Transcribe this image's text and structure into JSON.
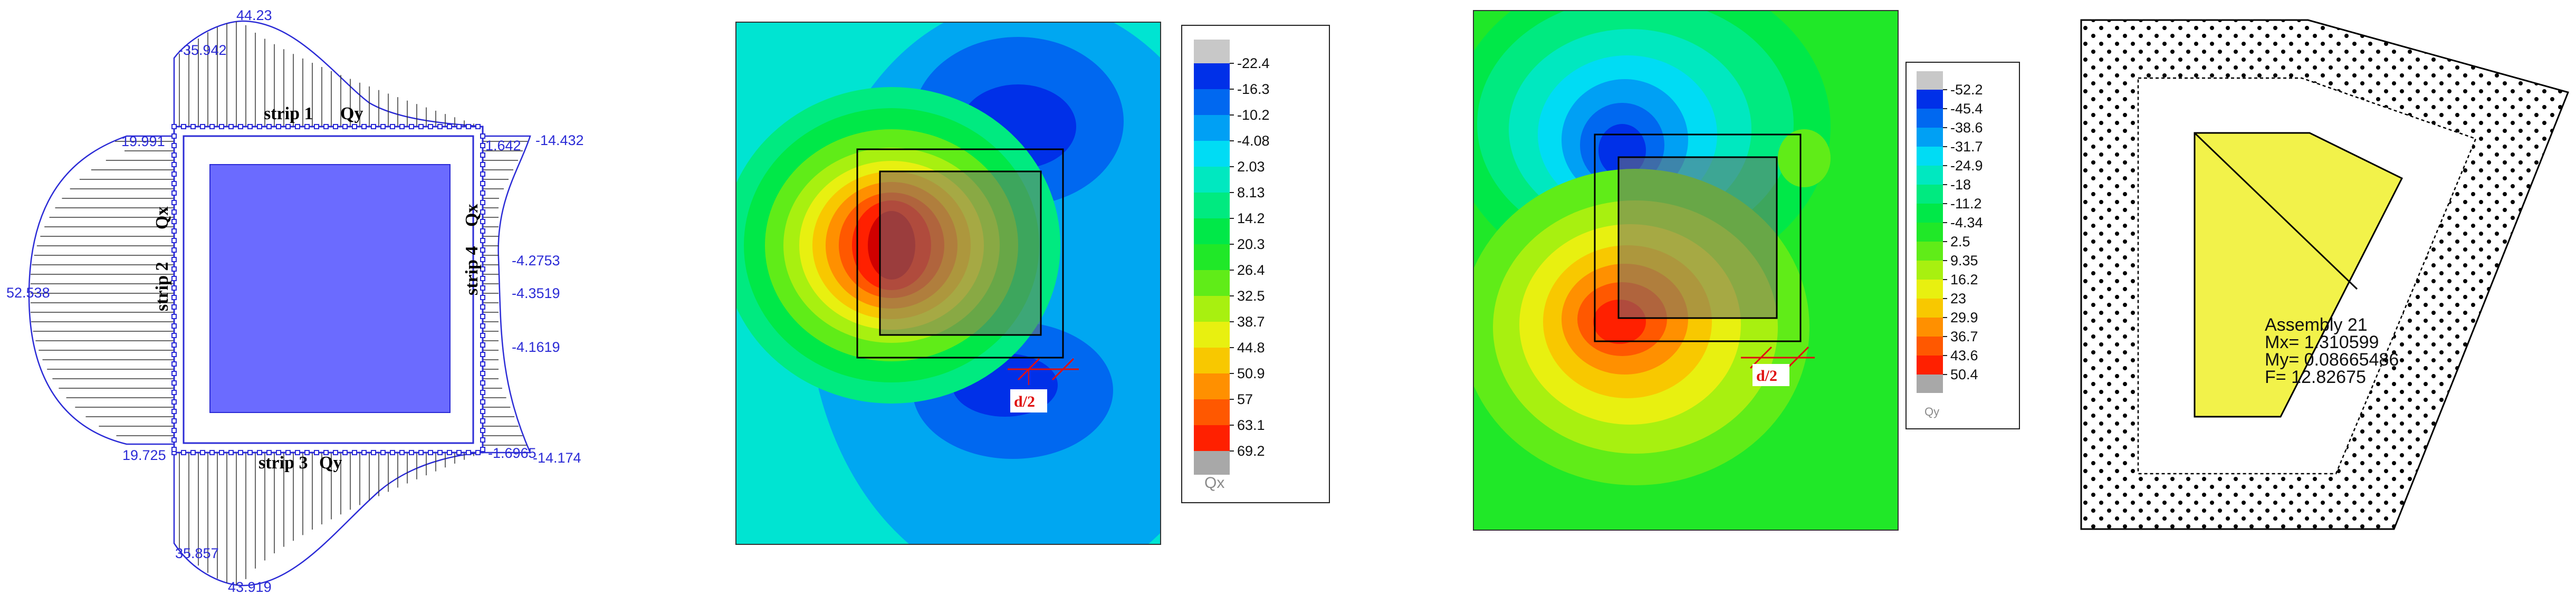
{
  "panel1": {
    "strip_labels": [
      "strip 1",
      "strip 2",
      "strip 3",
      "strip 4"
    ],
    "force_labels": [
      "Qy",
      "Qx",
      "Qy",
      "Qx"
    ],
    "values": {
      "top_peak": "44.23",
      "top_left": "-35.942",
      "top_right_outer": "-14.432",
      "top_right_inner": "1.642",
      "left_top": "19.991",
      "left_peak": "52.538",
      "left_bottom": "19.725",
      "right_1": "-4.2753",
      "right_2": "-4.3519",
      "right_3": "-4.1619",
      "bottom_right_inner": "-1.6965",
      "bottom_right_outer": "-14.174",
      "bottom_left": "35.857",
      "bottom_peak": "43.919"
    },
    "colors": {
      "column": "#6b6bff",
      "outline": "#2b2bd6"
    }
  },
  "panel2": {
    "legend_values": [
      "-22.4",
      "-16.3",
      "-10.2",
      "-4.08",
      "2.03",
      "8.13",
      "14.2",
      "20.3",
      "26.4",
      "32.5",
      "38.7",
      "44.8",
      "50.9",
      "57",
      "63.1",
      "69.2"
    ],
    "legend_colors": [
      "#0030e8",
      "#0068f0",
      "#00a0f4",
      "#00dcf4",
      "#00e8c0",
      "#00ea80",
      "#00e848",
      "#20e828",
      "#60ec18",
      "#a8f010",
      "#e8f010",
      "#f8c800",
      "#ff9000",
      "#ff5800",
      "#ff2000"
    ],
    "unit_label": "Qx",
    "marker": "d/2"
  },
  "panel3": {
    "legend_values": [
      "-52.2",
      "-45.4",
      "-38.6",
      "-31.7",
      "-24.9",
      "-18",
      "-11.2",
      "-4.34",
      "2.5",
      "9.35",
      "16.2",
      "23",
      "29.9",
      "36.7",
      "43.6",
      "50.4"
    ],
    "legend_colors": [
      "#0030e8",
      "#0068f0",
      "#00a0f4",
      "#00dcf4",
      "#00e8c0",
      "#00ea80",
      "#00e848",
      "#20e828",
      "#60ec18",
      "#a8f010",
      "#e8f010",
      "#f8c800",
      "#ff9000",
      "#ff5800",
      "#ff2000"
    ],
    "unit_label": "Qy",
    "marker": "d/2"
  },
  "panel4": {
    "assembly": [
      "Assembly 21",
      "Mx= 1.310599",
      "My= 0.08665486",
      "F= 12.82675"
    ],
    "fill_color": "#f2f24a"
  }
}
